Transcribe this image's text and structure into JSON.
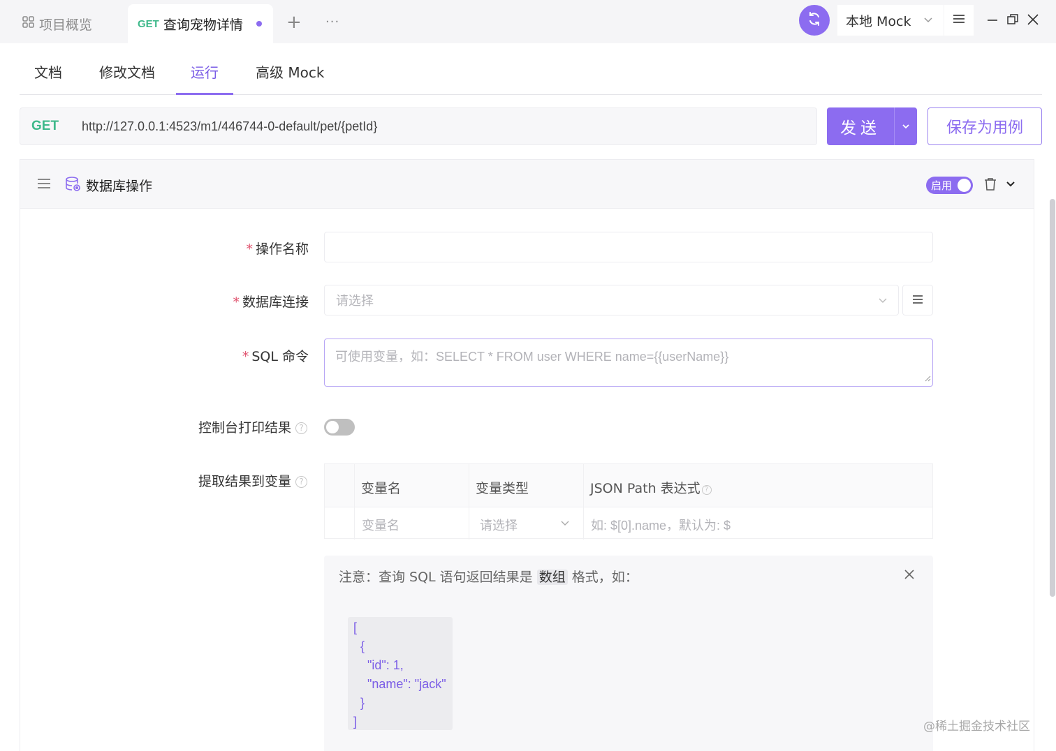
{
  "tabs": {
    "overview_label": "项目概览",
    "active_method": "GET",
    "active_title": "查询宠物详情",
    "add_label": "+",
    "more_label": "···"
  },
  "environment": {
    "selected": "本地 Mock"
  },
  "subtabs": [
    {
      "label": "文档"
    },
    {
      "label": "修改文档"
    },
    {
      "label": "运行"
    },
    {
      "label": "高级 Mock"
    }
  ],
  "request": {
    "method": "GET",
    "url": "http://127.0.0.1:4523/m1/446744-0-default/pet/{petId}",
    "send_label": "发送",
    "save_case_label": "保存为用例"
  },
  "db_operation": {
    "title": "数据库操作",
    "enable_label": "启用",
    "enabled": true,
    "fields": {
      "op_name_label": "操作名称",
      "op_name_value": "",
      "db_conn_label": "数据库连接",
      "db_conn_placeholder": "请选择",
      "sql_label": "SQL 命令",
      "sql_placeholder": "可使用变量，如：SELECT * FROM user WHERE name={{userName}}",
      "console_label": "控制台打印结果",
      "console_enabled": false,
      "extract_label": "提取结果到变量"
    },
    "var_table": {
      "headers": [
        "变量名",
        "变量类型",
        "JSON Path 表达式"
      ],
      "row_placeholders": [
        "变量名",
        "请选择",
        "如: $[0].name，默认为: $"
      ]
    },
    "notice": {
      "text_before": "注意：查询 SQL 语句返回结果是",
      "highlight": "数组",
      "text_after": "格式，如：",
      "code": "[\n  {\n    \"id\": 1,\n    \"name\": \"jack\"\n  }\n]"
    }
  },
  "watermark": "@稀土掘金技术社区",
  "colors": {
    "accent": "#8c6cf0",
    "get_method": "#3fb98b",
    "required": "#e0526e"
  }
}
